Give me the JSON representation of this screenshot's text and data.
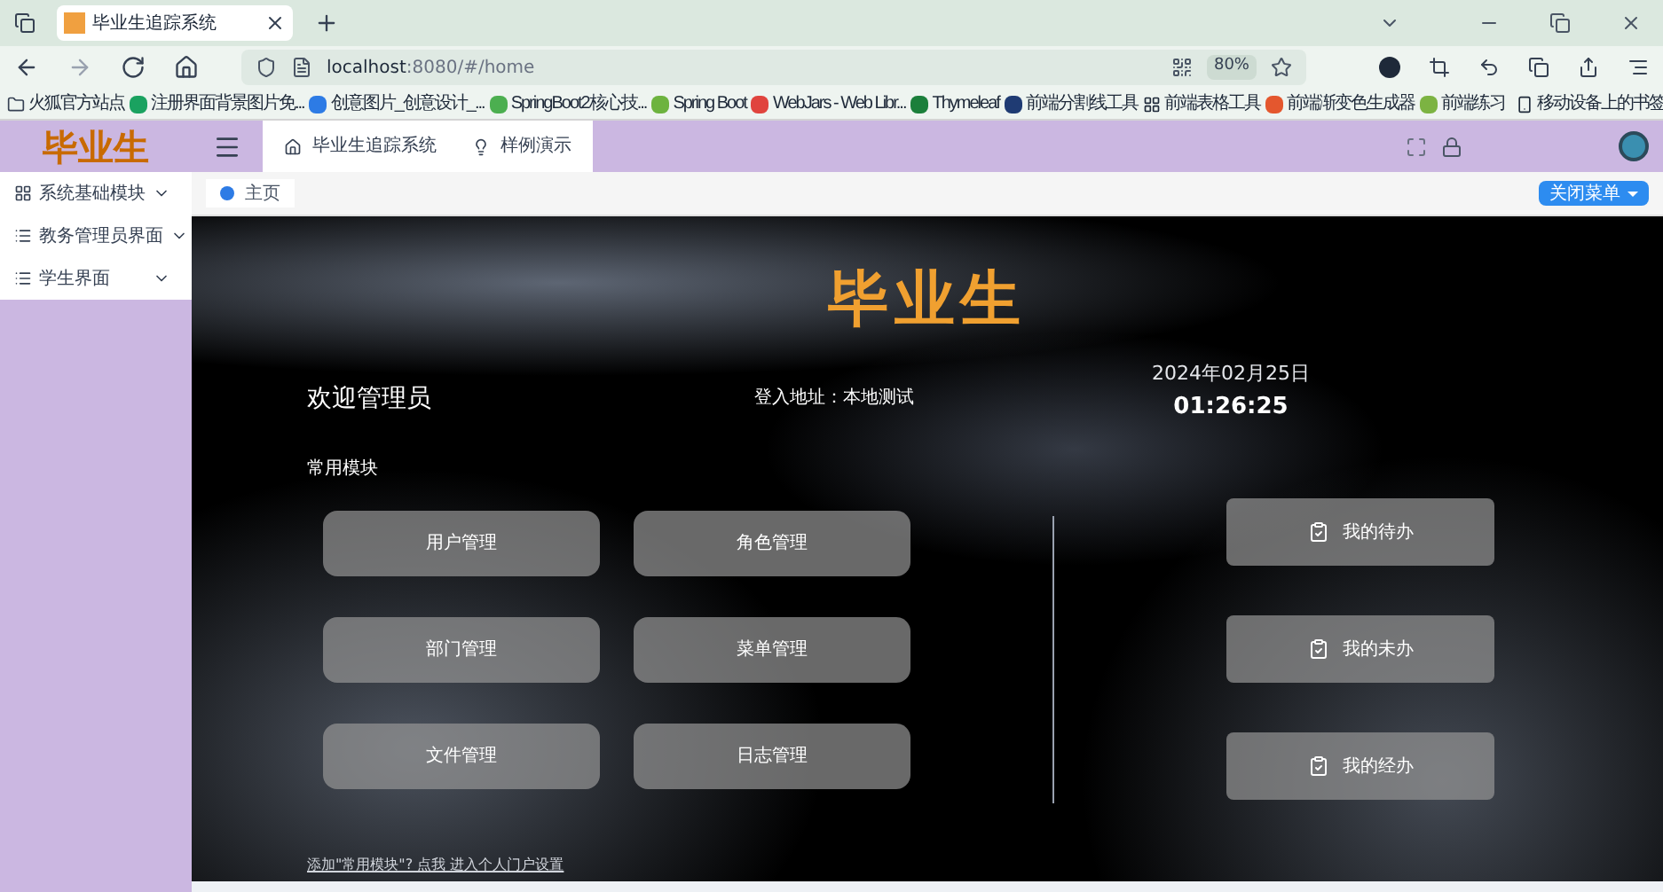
{
  "browser": {
    "tab_title": "毕业生追踪系统",
    "url_host": "localhost",
    "url_rest": ":8080/#/home",
    "zoom": "80%",
    "bookmarks": [
      "火狐官方站点",
      "注册界面背景图片免...",
      "创意图片_创意设计_...",
      "SpringBoot2核心技...",
      "Spring Boot",
      "WebJars - Web Libr...",
      "Thymeleaf",
      "前端分割线工具",
      "前端表格工具",
      "前端渐变色生成器",
      "前端练习"
    ],
    "mobile_bookmarks": "移动设备上的书签"
  },
  "app": {
    "logo": "毕业生",
    "sidebar": [
      "系统基础模块",
      "教务管理员界面",
      "学生界面"
    ],
    "header_tabs": [
      "毕业生追踪系统",
      "样例演示"
    ],
    "breadcrumb": "主页",
    "close_menu": "关闭菜单",
    "hero": {
      "title": "毕业生",
      "welcome": "欢迎管理员",
      "login": "登入地址：本地测试",
      "date": "2024年02月25日",
      "time": "01:26:25",
      "section": "常用模块",
      "modules": [
        "用户管理",
        "角色管理",
        "部门管理",
        "菜单管理",
        "文件管理",
        "日志管理"
      ],
      "tasks": [
        "我的待办",
        "我的未办",
        "我的经办"
      ],
      "footer_link": "添加\"常用模块\"? 点我 进入个人门户设置"
    }
  }
}
